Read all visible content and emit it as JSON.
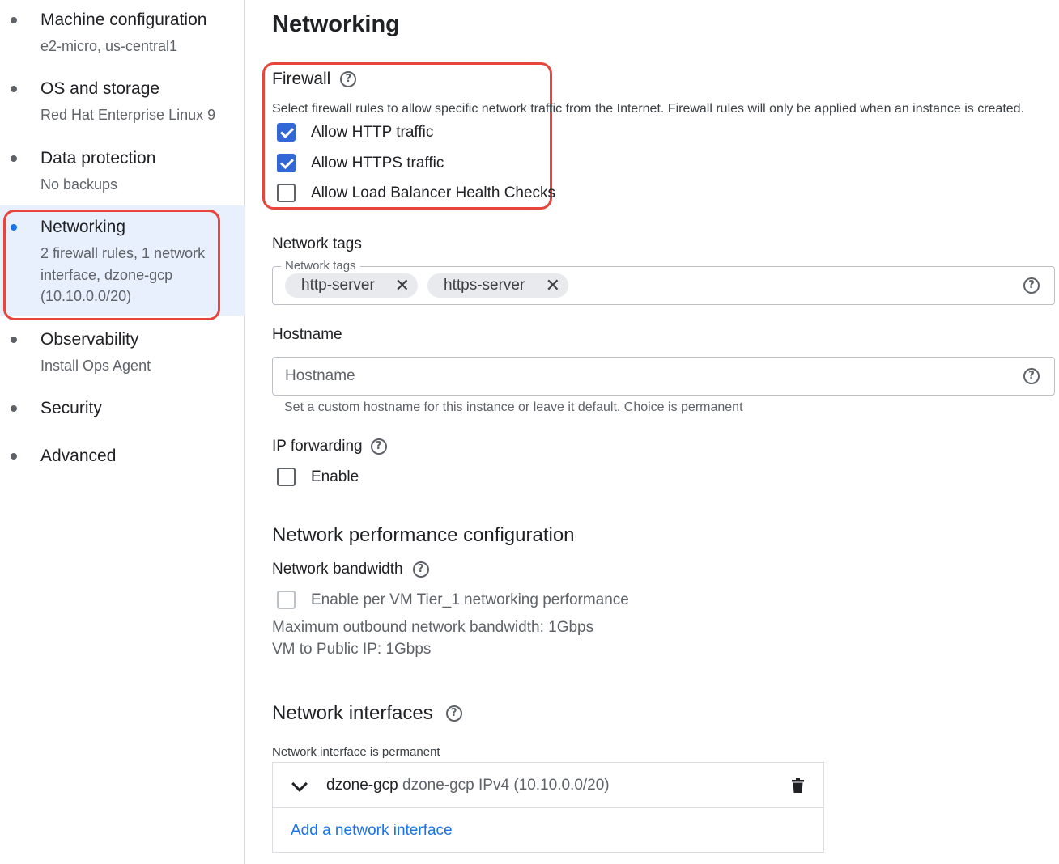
{
  "sidebar": {
    "items": [
      {
        "title": "Machine configuration",
        "subtitle": "e2-micro, us-central1"
      },
      {
        "title": "OS and storage",
        "subtitle": "Red Hat Enterprise Linux 9"
      },
      {
        "title": "Data protection",
        "subtitle": "No backups"
      },
      {
        "title": "Networking",
        "subtitle": "2 firewall rules, 1 network interface, dzone-gcp (10.10.0.0/20)",
        "active": true
      },
      {
        "title": "Observability",
        "subtitle": "Install Ops Agent"
      },
      {
        "title": "Security",
        "subtitle": ""
      },
      {
        "title": "Advanced",
        "subtitle": ""
      }
    ]
  },
  "main": {
    "page_title": "Networking",
    "firewall": {
      "heading": "Firewall",
      "description": "Select firewall rules to allow specific network traffic from the Internet. Firewall rules will only be applied when an instance is created.",
      "options": [
        {
          "label": "Allow HTTP traffic",
          "checked": true
        },
        {
          "label": "Allow HTTPS traffic",
          "checked": true
        },
        {
          "label": "Allow Load Balancer Health Checks",
          "checked": false
        }
      ]
    },
    "network_tags": {
      "heading": "Network tags",
      "field_label": "Network tags",
      "chips": [
        "http-server",
        "https-server"
      ],
      "remove_glyph": "✕"
    },
    "hostname": {
      "heading": "Hostname",
      "placeholder": "Hostname",
      "hint": "Set a custom hostname for this instance or leave it default. Choice is permanent"
    },
    "ip_forwarding": {
      "heading": "IP forwarding",
      "enable_label": "Enable",
      "checked": false
    },
    "performance": {
      "heading": "Network performance configuration",
      "bandwidth_heading": "Network bandwidth",
      "tier1_label": "Enable per VM Tier_1 networking performance",
      "tier1_checked": false,
      "max_outbound": "Maximum outbound network bandwidth: 1Gbps",
      "vm_public": "VM to Public IP: 1Gbps"
    },
    "interfaces": {
      "heading": "Network interfaces",
      "permanent_note": "Network interface is permanent",
      "items": [
        {
          "name": "dzone-gcp",
          "detail": "dzone-gcp IPv4 (10.10.0.0/20)"
        }
      ],
      "add_link": "Add a network interface"
    },
    "help_glyph": "?"
  },
  "colors": {
    "accent": "#1a73e8",
    "checkbox_checked": "#3367d6",
    "highlight_outline": "#e8453c",
    "active_nav_bg": "#e8f0fe"
  }
}
